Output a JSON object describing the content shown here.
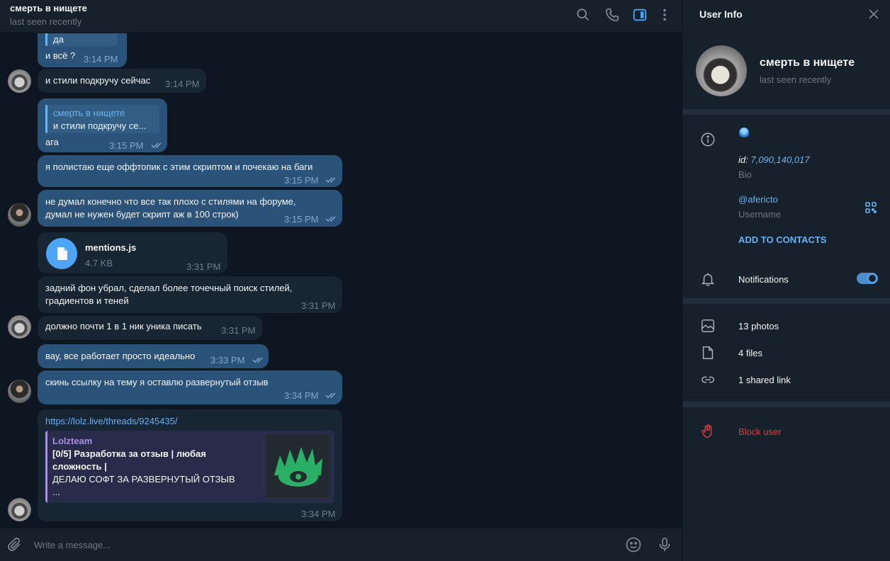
{
  "chat": {
    "title": "смерть в нищете",
    "status": "last seen recently",
    "header_icons": [
      "search-icon",
      "phone-icon",
      "sidebar-icon",
      "more-vertical-icon"
    ],
    "accent": "#6ab2f2"
  },
  "messages": {
    "m1_text1": "да",
    "m1_text2": "и всё ?",
    "m1_time": "3:14 PM",
    "m2_text": "и стили подкручу сейчас",
    "m2_time": "3:14 PM",
    "m3_reply_name": "смерть в нищете",
    "m3_reply_text": "и стили подкручу се...",
    "m3_text": "ага",
    "m3_time": "3:15 PM",
    "m4_text": "я полистаю еще оффтопик с этим скриптом и почекаю на баги",
    "m4_time": "3:15 PM",
    "m5_text1": "не думал конечно что все так плохо с стилями на форуме,",
    "m5_text2": "думал не нужен будет скрипт аж в 100 строк)",
    "m5_time": "3:15 PM",
    "m6_file_name": "mentions.js",
    "m6_file_size": "4.7 KB",
    "m6_time": "3:31 PM",
    "m7_text1": "задний фон убрал, сделал более точечный поиск стилей,",
    "m7_text2": "градиентов и теней",
    "m7_time": "3:31 PM",
    "m8_text": "должно почти 1 в 1 ник уника писать",
    "m8_time": "3:31 PM",
    "m9_text": "вау, все работает просто идеально",
    "m9_time": "3:33 PM",
    "m10_text": "скинь ссылку на тему я оставлю развернутый отзыв",
    "m10_time": "3:34 PM",
    "m11_url": "https://lolz.live/threads/9245435/",
    "m11_site": "Lolzteam",
    "m11_title1": "[0/5] Разработка за отзыв | любая",
    "m11_title2": "сложность |",
    "m11_desc": "ДЕЛАЮ СОФТ ЗА РАЗВЕРНУТЫЙ ОТЗЫВ",
    "m11_more": "...",
    "m11_time": "3:34 PM"
  },
  "composer": {
    "placeholder": "Write a message...",
    "icons": [
      "paperclip-icon",
      "emoji-icon",
      "microphone-icon"
    ]
  },
  "panel": {
    "title": "User Info",
    "name": "смерть в нищете",
    "status": "last seen recently",
    "id_label": "id:",
    "id_value": "7,090,140,017",
    "bio_label": "Bio",
    "username": "@afericto",
    "username_label": "Username",
    "add_contacts": "ADD TO CONTACTS",
    "notifications_label": "Notifications",
    "notifications_on": true,
    "photos": "13 photos",
    "files": "4 files",
    "links": "1 shared link",
    "block": "Block user",
    "danger_color": "#e53935"
  }
}
